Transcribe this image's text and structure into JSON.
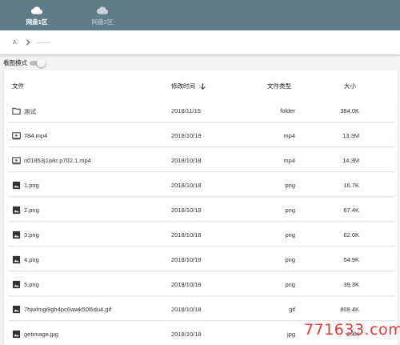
{
  "tabs": [
    {
      "label": "网盘1区",
      "icon": "cloud-icon",
      "active": true
    },
    {
      "label": "网盘2区",
      "icon": "cloud-icon",
      "active": false
    }
  ],
  "breadcrumb": {
    "root": "A"
  },
  "view_mode": {
    "label": "看图模式",
    "enabled": false
  },
  "columns": {
    "name": "文件",
    "date": "修改时间",
    "type": "文件类型",
    "size": "大小"
  },
  "files": [
    {
      "name": "测试",
      "date": "2018/11/15",
      "type": "folder",
      "size": "384.0K",
      "icon": "folder-icon"
    },
    {
      "name": "784.mp4",
      "date": "2018/10/18",
      "type": "mp4",
      "size": "13.3M",
      "icon": "video-icon"
    },
    {
      "name": "n01853j1wkr.p702.1.mp4",
      "date": "2018/10/18",
      "type": "mp4",
      "size": "14.3M",
      "icon": "video-icon"
    },
    {
      "name": "1.png",
      "date": "2018/10/18",
      "type": "png",
      "size": "16.7K",
      "icon": "image-icon"
    },
    {
      "name": "2.png",
      "date": "2018/10/18",
      "type": "png",
      "size": "67.4K",
      "icon": "image-icon"
    },
    {
      "name": "3.png",
      "date": "2018/10/18",
      "type": "png",
      "size": "62.0K",
      "icon": "image-icon"
    },
    {
      "name": "4.png",
      "date": "2018/10/18",
      "type": "png",
      "size": "54.9K",
      "icon": "image-icon"
    },
    {
      "name": "5.png",
      "date": "2018/10/18",
      "type": "png",
      "size": "39.3K",
      "icon": "image-icon"
    },
    {
      "name": "7hjwlmgi9gh4pc6wwk50l5du4.gif",
      "date": "2018/10/18",
      "type": "gif",
      "size": "808.4K",
      "icon": "image-icon"
    },
    {
      "name": "getimage.jpg",
      "date": "2018/10/18",
      "type": "jpg",
      "size": "2.4K",
      "icon": "image-icon"
    }
  ],
  "watermark": "771633.com",
  "colors": {
    "header_bar": "#607d8b",
    "watermark": "#e53935"
  }
}
